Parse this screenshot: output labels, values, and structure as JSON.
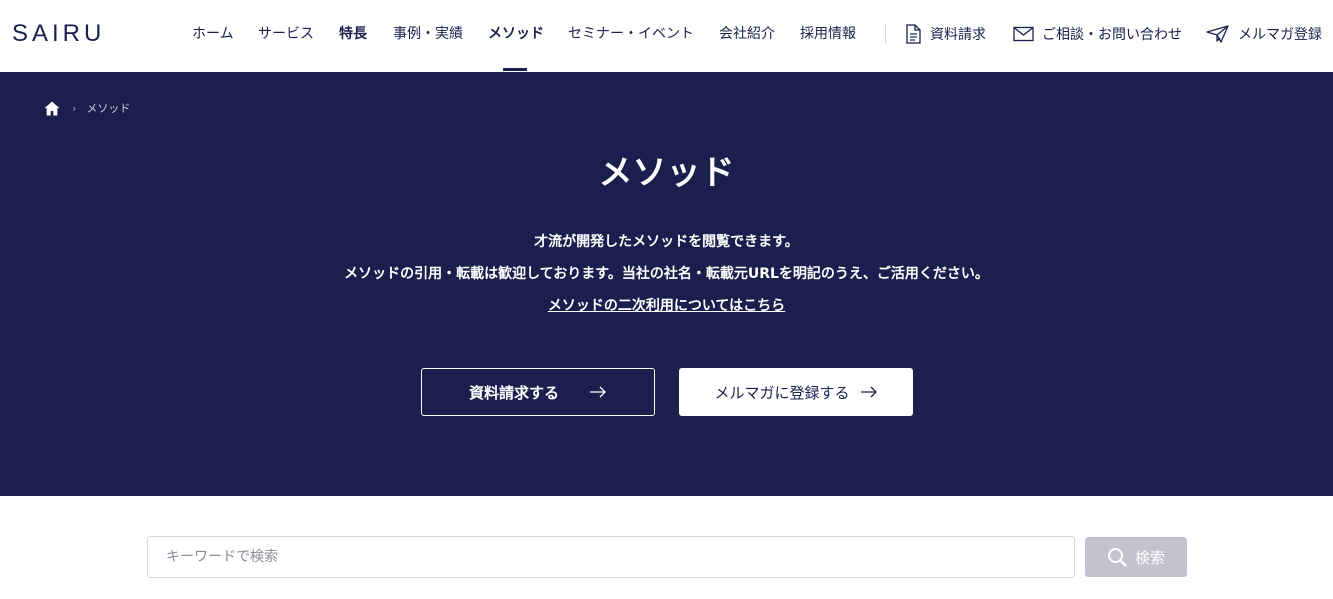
{
  "header": {
    "logo": "SAIRU",
    "nav": [
      {
        "label": "ホーム"
      },
      {
        "label": "サービス"
      },
      {
        "label": "特長"
      },
      {
        "label": "事例・実績"
      },
      {
        "label": "メソッド"
      },
      {
        "label": "セミナー・イベント"
      },
      {
        "label": "会社紹介"
      },
      {
        "label": "採用情報"
      }
    ],
    "active_nav": "メソッド",
    "utility": [
      {
        "label": "資料請求",
        "icon": "document-icon"
      },
      {
        "label": "ご相談・お問い合わせ",
        "icon": "mail-icon"
      },
      {
        "label": "メルマガ登録",
        "icon": "paper-plane-icon"
      }
    ]
  },
  "breadcrumb": {
    "home_icon": "home-icon",
    "current": "メソッド"
  },
  "hero": {
    "title": "メソッド",
    "line1": "才流が開発したメソッドを閲覧できます。",
    "line2": "メソッドの引用・転載は歓迎しております。当社の社名・転載元URLを明記のうえ、ご活用ください。",
    "link": "メソッドの二次利用についてはこちら",
    "buttons": {
      "request": "資料請求する",
      "newsletter": "メルマガに登録する"
    }
  },
  "search": {
    "placeholder": "キーワードで検索",
    "value": "",
    "button": "検索"
  },
  "colors": {
    "primary": "#1b1f4d",
    "search_button": "#c2c3cd"
  }
}
